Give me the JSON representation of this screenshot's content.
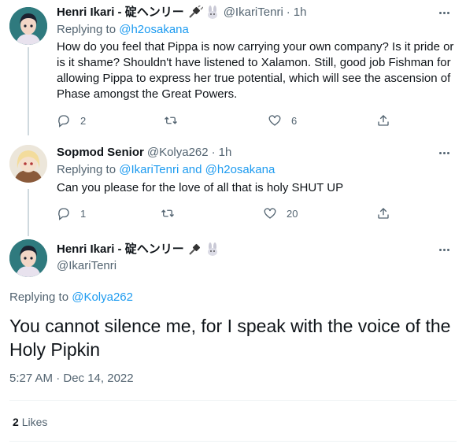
{
  "tweets": [
    {
      "name": "Henri Ikari - 碇ヘンリー",
      "emoji": [
        "plug-emoji",
        "rabbit-emoji"
      ],
      "handle": "@IkariTenri",
      "dot": "·",
      "time": "1h",
      "replying_prefix": "Replying to",
      "replying_to": "@h2osakana",
      "text": "How do you feel that Pippa is now carrying your own company? Is it pride or is it shame? Shouldn't have listened to Xalamon. Still, good job Fishman for allowing Pippa to express her true potential, which will see the ascension of Phase amongst the Great Powers.",
      "replies": "2",
      "retweets": "",
      "likes": "6"
    },
    {
      "name": "Sopmod Senior",
      "handle": "@Kolya262",
      "dot": "·",
      "time": "1h",
      "replying_prefix": "Replying to",
      "replying_to": "@IkariTenri and @h2osakana",
      "text": "Can you please for the love of all that is holy SHUT UP",
      "replies": "1",
      "retweets": "",
      "likes": "20"
    }
  ],
  "main_tweet": {
    "name": "Henri Ikari - 碇ヘンリー",
    "emoji": [
      "plug-emoji",
      "rabbit-emoji"
    ],
    "handle": "@IkariTenri",
    "replying_prefix": "Replying to",
    "replying_to": "@Kolya262",
    "text": "You cannot silence me, for I speak with the voice of the Holy Pipkin",
    "timestamp": "5:27 AM · Dec 14, 2022",
    "likes_count": "2",
    "likes_label": "Likes"
  },
  "colors": {
    "accent": "#1d9bf0",
    "secondary_text": "#536471",
    "primary_text": "#0f1419",
    "divider": "#eff3f4"
  }
}
